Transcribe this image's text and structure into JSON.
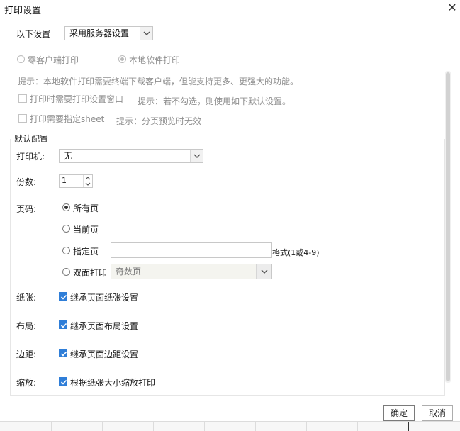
{
  "window": {
    "title": "打印设置"
  },
  "settings_row": {
    "label": "以下设置",
    "selected": "采用服务器设置"
  },
  "print_mode": {
    "zero_client": "零客户端打印",
    "local_software": "本地软件打印",
    "hint": "提示：本地软件打印需要终端下载客户端，但能支持更多、更强大的功能。"
  },
  "options": {
    "show_dialog_label": "打印时需要打印设置窗口",
    "show_dialog_hint": "提示：若不勾选，则使用如下默认设置。",
    "specify_sheet_label": "打印需要指定sheet",
    "specify_sheet_hint": "提示：分页预览时无效"
  },
  "default_config": {
    "title": "默认配置",
    "printer_label": "打印机:",
    "printer_value": "无",
    "copies_label": "份数:",
    "copies_value": "1",
    "pages_label": "页码:",
    "pages_all": "所有页",
    "pages_current": "当前页",
    "pages_specify": "指定页",
    "pages_specify_value": "",
    "pages_format_hint": "格式(1或4-9)",
    "pages_duplex": "双面打印",
    "pages_duplex_value": "奇数页",
    "paper_label": "纸张:",
    "paper_option": "继承页面纸张设置",
    "layout_label": "布局:",
    "layout_option": "继承页面布局设置",
    "margin_label": "边距:",
    "margin_option": "继承页面边距设置",
    "scale_label": "缩放:",
    "scale_option": "根据纸张大小缩放打印"
  },
  "footer": {
    "ok": "确定",
    "cancel": "取消"
  },
  "colors": {
    "checkbox_accent": "#2f7ed8",
    "muted_text": "#8f8f8f"
  }
}
